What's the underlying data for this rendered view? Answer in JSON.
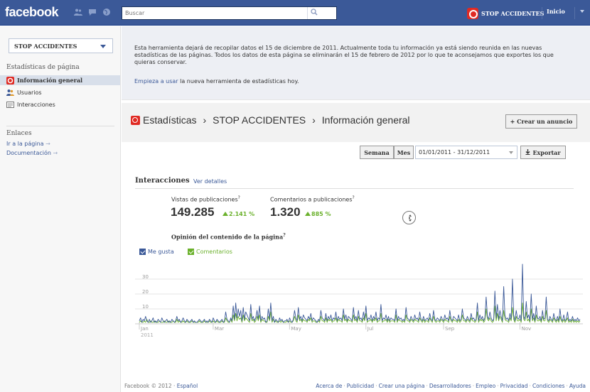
{
  "topbar": {
    "logo": "facebook",
    "search_placeholder": "Buscar",
    "page_name": "STOP ACCIDENTES",
    "home": "Inicio"
  },
  "sidebar": {
    "page_selector": "STOP ACCIDENTES",
    "section_title": "Estadísticas de página",
    "items": [
      {
        "label": "Información general",
        "active": true
      },
      {
        "label": "Usuarios",
        "active": false
      },
      {
        "label": "Interacciones",
        "active": false
      }
    ],
    "links_title": "Enlaces",
    "links": [
      "Ir a la página",
      "Documentación"
    ],
    "link_arrow": "→"
  },
  "notice": {
    "text": "Esta herramienta dejará de recopilar datos el 15 de diciembre de 2011. Actualmente toda tu información ya está siendo reunida en las nuevas estadísticas de las páginas. Todos los datos de esta página se eliminarán el 15 de febrero de 2012 por lo que te aconsejamos que exportes los que quieras conservar.",
    "link": "Empieza a usar",
    "link_suffix": " la nueva herramienta de estadísticas hoy."
  },
  "breadcrumb": {
    "root": "Estadísticas",
    "page": "STOP ACCIDENTES",
    "current": "Información general",
    "separator": "›"
  },
  "create_ad_label": "+ Crear un anuncio",
  "controls": {
    "week": "Semana",
    "month": "Mes",
    "date_range": "01/01/2011 - 31/12/2011",
    "export": "Exportar"
  },
  "interactions": {
    "title": "Interacciones",
    "details_link": "Ver detalles",
    "metrics": [
      {
        "label": "Vistas de publicaciones",
        "value": "149.285",
        "change": "2.141 %"
      },
      {
        "label": "Comentarios a publicaciones",
        "value": "1.320",
        "change": "885 %"
      }
    ],
    "help_mark": "?",
    "opinion_title": "Opinión del contenido de la página",
    "legend": [
      {
        "label": "Me gusta",
        "color": "#3b5998"
      },
      {
        "label": "Comentarios",
        "color": "#6bb12c"
      }
    ]
  },
  "chart_data": {
    "type": "line",
    "x_ticks": [
      "Jan",
      "Mar",
      "May",
      "Jul",
      "Sep",
      "Nov"
    ],
    "x_year": "2011",
    "y_ticks": [
      10,
      20,
      30
    ],
    "ylim": [
      0,
      40
    ],
    "grid": true,
    "legend": "top-left",
    "series": [
      {
        "name": "Me gusta",
        "color": "#3b5998",
        "values": [
          2,
          4,
          1,
          3,
          2,
          5,
          2,
          1,
          3,
          1,
          2,
          4,
          1,
          2,
          1,
          3,
          2,
          1,
          4,
          2,
          1,
          2,
          3,
          1,
          2,
          1,
          3,
          2,
          1,
          2,
          5,
          2,
          3,
          1,
          2,
          4,
          2,
          1,
          3,
          2,
          1,
          2,
          3,
          1,
          2,
          1,
          1,
          2,
          3,
          2,
          1,
          2,
          3,
          1,
          2,
          1,
          3,
          2,
          1,
          4,
          2,
          1,
          3,
          2,
          1,
          2,
          3,
          1,
          2,
          8,
          3,
          2,
          1,
          4,
          2,
          12,
          3,
          14,
          4,
          10,
          5,
          9,
          2,
          11,
          3,
          8,
          6,
          4,
          2,
          13,
          3,
          5,
          2,
          4,
          9,
          3,
          12,
          2,
          5,
          3,
          4,
          1,
          2,
          10,
          3,
          14,
          2,
          5,
          1,
          3,
          2,
          1,
          4,
          2,
          3,
          1,
          2,
          2,
          3,
          1,
          4,
          2,
          1,
          3,
          9,
          4,
          2,
          11,
          3,
          5,
          2,
          6,
          4,
          3,
          2,
          5,
          3,
          7,
          2,
          4,
          3,
          2,
          1,
          3,
          2,
          9,
          4,
          3,
          2,
          7,
          2,
          5,
          3,
          6,
          2,
          4,
          3,
          8,
          2,
          5,
          3,
          4,
          2,
          10,
          3,
          6,
          2,
          5,
          4,
          3,
          2,
          11,
          3,
          5,
          2,
          9,
          3,
          4,
          2,
          8,
          3,
          12,
          2,
          4,
          3,
          6,
          2,
          5,
          3,
          8,
          2,
          4,
          3,
          13,
          2,
          4,
          3,
          6,
          2,
          5,
          2,
          4,
          3,
          3,
          2,
          10,
          2,
          5,
          3,
          4,
          2,
          3,
          2,
          11,
          4,
          3,
          2,
          5,
          3,
          2,
          6,
          3,
          4,
          2,
          8,
          3,
          2,
          5,
          2,
          3,
          4,
          2,
          7,
          3,
          2,
          9,
          3,
          2,
          4,
          3,
          2,
          5,
          3,
          2,
          6,
          3,
          4,
          2,
          9,
          3,
          2,
          5,
          4,
          3,
          2,
          6,
          2,
          3,
          10,
          4,
          3,
          2,
          5,
          3,
          2,
          7,
          3,
          4,
          2,
          3,
          14,
          2,
          6,
          3,
          5,
          2,
          4,
          18,
          5,
          3,
          8,
          4,
          2,
          3,
          22,
          4,
          13,
          3,
          9,
          5,
          2,
          25,
          6,
          3,
          4,
          2,
          7,
          3,
          30,
          6,
          2,
          9,
          4,
          3,
          6,
          2,
          40,
          5,
          3,
          15,
          4,
          6,
          2,
          20,
          3,
          7,
          2,
          12,
          4,
          3,
          5,
          2,
          9,
          3,
          4,
          18,
          3,
          2,
          5,
          3,
          2,
          7,
          3,
          2,
          5,
          2,
          10,
          3,
          2,
          6,
          2,
          3,
          8,
          2,
          3,
          2,
          5,
          2,
          3,
          2,
          4,
          2,
          3
        ]
      },
      {
        "name": "Comentarios",
        "color": "#6bb12c",
        "values": [
          1,
          2,
          1,
          1,
          2,
          1,
          3,
          1,
          1,
          2,
          1,
          1,
          2,
          1,
          1,
          1,
          2,
          1,
          1,
          1,
          2,
          1,
          1,
          2,
          1,
          1,
          1,
          2,
          1,
          1,
          3,
          1,
          2,
          1,
          1,
          2,
          1,
          1,
          2,
          1,
          1,
          1,
          2,
          1,
          1,
          1,
          1,
          1,
          2,
          1,
          1,
          1,
          2,
          1,
          1,
          1,
          2,
          1,
          1,
          2,
          1,
          1,
          2,
          1,
          1,
          1,
          2,
          1,
          1,
          4,
          2,
          1,
          1,
          3,
          1,
          6,
          2,
          7,
          2,
          5,
          3,
          4,
          1,
          6,
          2,
          4,
          3,
          2,
          1,
          7,
          2,
          3,
          1,
          2,
          5,
          2,
          6,
          1,
          3,
          2,
          2,
          1,
          1,
          5,
          2,
          8,
          1,
          3,
          1,
          2,
          1,
          1,
          2,
          1,
          2,
          1,
          1,
          1,
          2,
          1,
          2,
          1,
          1,
          2,
          5,
          2,
          1,
          6,
          2,
          3,
          1,
          3,
          2,
          2,
          1,
          3,
          2,
          4,
          1,
          2,
          2,
          1,
          1,
          2,
          1,
          5,
          2,
          2,
          1,
          4,
          1,
          3,
          2,
          3,
          1,
          2,
          2,
          4,
          1,
          3,
          2,
          2,
          1,
          6,
          2,
          3,
          1,
          3,
          2,
          2,
          1,
          6,
          2,
          3,
          1,
          5,
          2,
          2,
          1,
          4,
          2,
          7,
          1,
          2,
          2,
          3,
          1,
          3,
          2,
          4,
          1,
          2,
          2,
          7,
          1,
          2,
          2,
          3,
          1,
          3,
          1,
          2,
          2,
          2,
          1,
          6,
          1,
          3,
          2,
          2,
          1,
          2,
          1,
          6,
          2,
          2,
          1,
          3,
          2,
          1,
          3,
          2,
          2,
          1,
          4,
          2,
          1,
          3,
          1,
          2,
          2,
          1,
          4,
          2,
          1,
          5,
          2,
          1,
          2,
          2,
          1,
          3,
          2,
          1,
          3,
          2,
          2,
          1,
          5,
          2,
          1,
          3,
          2,
          2,
          1,
          3,
          1,
          2,
          6,
          2,
          2,
          1,
          3,
          2,
          1,
          4,
          2,
          2,
          1,
          2,
          8,
          1,
          3,
          2,
          3,
          1,
          2,
          10,
          3,
          2,
          4,
          2,
          1,
          2,
          12,
          2,
          7,
          2,
          5,
          3,
          1,
          9,
          3,
          2,
          2,
          1,
          4,
          2,
          11,
          3,
          1,
          5,
          2,
          2,
          3,
          1,
          14,
          3,
          2,
          8,
          2,
          3,
          1,
          10,
          2,
          4,
          1,
          6,
          2,
          2,
          3,
          1,
          5,
          2,
          2,
          9,
          2,
          1,
          3,
          2,
          1,
          4,
          2,
          1,
          3,
          1,
          5,
          2,
          1,
          3,
          1,
          2,
          4,
          1,
          2,
          1,
          3,
          1,
          2,
          1,
          2,
          1,
          2
        ]
      }
    ]
  },
  "footer": {
    "copyright": "Facebook © 2012 · ",
    "language": "Español",
    "links": [
      "Acerca de",
      "Publicidad",
      "Crear una página",
      "Desarrolladores",
      "Empleo",
      "Privacidad",
      "Condiciones",
      "Ayuda"
    ],
    "separator": "·"
  }
}
